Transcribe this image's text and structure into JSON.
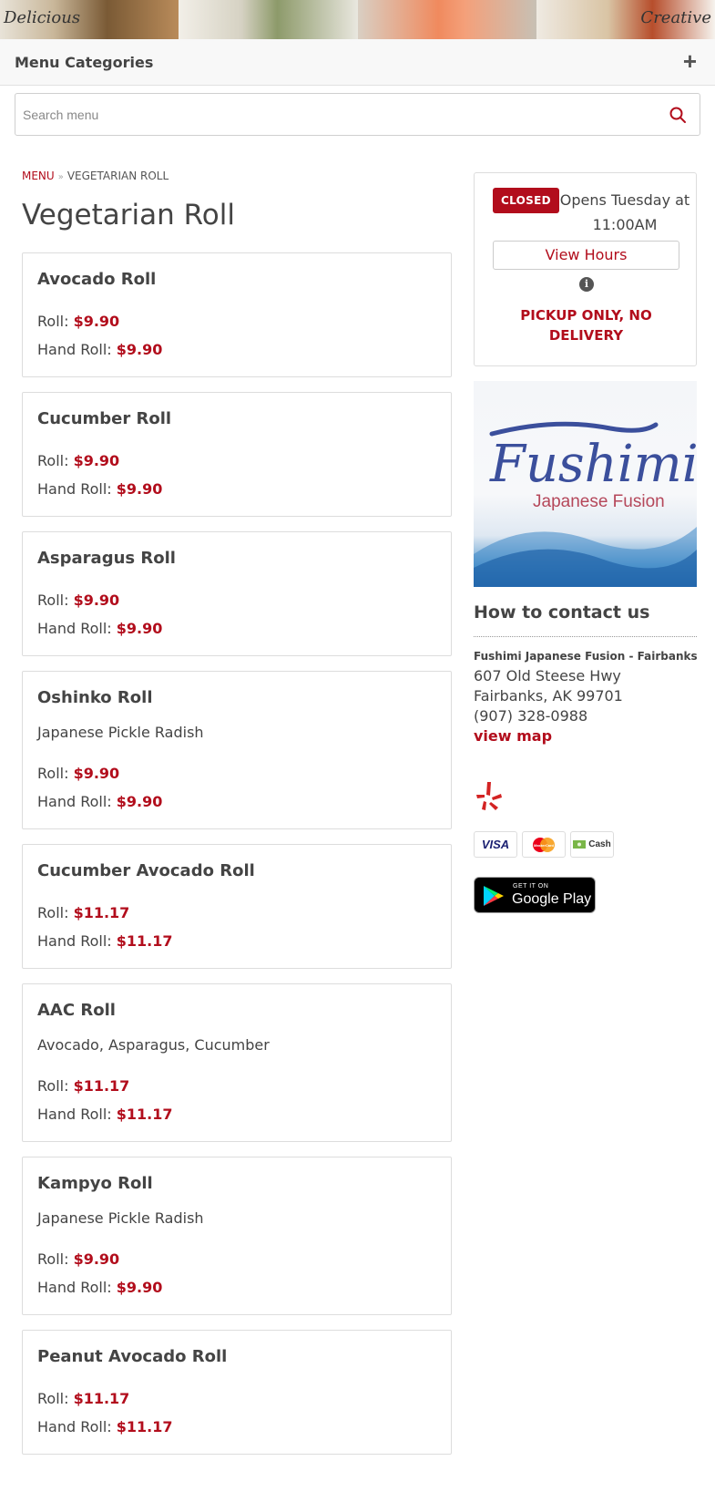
{
  "banner": {
    "left_word": "Delicious",
    "right_word": "Creative"
  },
  "categories_bar": {
    "label": "Menu Categories",
    "toggle": "+"
  },
  "search": {
    "placeholder": "Search menu"
  },
  "breadcrumb": {
    "home": "MENU",
    "separator": "»",
    "current": "VEGETARIAN ROLL"
  },
  "page_title": "Vegetarian Roll",
  "items": [
    {
      "name": "Avocado Roll",
      "description": "",
      "prices": [
        {
          "label": "Roll:",
          "amount": "$9.90"
        },
        {
          "label": "Hand Roll:",
          "amount": "$9.90"
        }
      ]
    },
    {
      "name": "Cucumber Roll",
      "description": "",
      "prices": [
        {
          "label": "Roll:",
          "amount": "$9.90"
        },
        {
          "label": "Hand Roll:",
          "amount": "$9.90"
        }
      ]
    },
    {
      "name": "Asparagus Roll",
      "description": "",
      "prices": [
        {
          "label": "Roll:",
          "amount": "$9.90"
        },
        {
          "label": "Hand Roll:",
          "amount": "$9.90"
        }
      ]
    },
    {
      "name": "Oshinko Roll",
      "description": "Japanese Pickle Radish",
      "prices": [
        {
          "label": "Roll:",
          "amount": "$9.90"
        },
        {
          "label": "Hand Roll:",
          "amount": "$9.90"
        }
      ]
    },
    {
      "name": "Cucumber Avocado Roll",
      "description": "",
      "prices": [
        {
          "label": "Roll:",
          "amount": "$11.17"
        },
        {
          "label": "Hand Roll:",
          "amount": "$11.17"
        }
      ]
    },
    {
      "name": "AAC Roll",
      "description": "Avocado, Asparagus, Cucumber",
      "prices": [
        {
          "label": "Roll:",
          "amount": "$11.17"
        },
        {
          "label": "Hand Roll:",
          "amount": "$11.17"
        }
      ]
    },
    {
      "name": "Kampyo Roll",
      "description": "Japanese Pickle Radish",
      "prices": [
        {
          "label": "Roll:",
          "amount": "$9.90"
        },
        {
          "label": "Hand Roll:",
          "amount": "$9.90"
        }
      ]
    },
    {
      "name": "Peanut Avocado Roll",
      "description": "",
      "prices": [
        {
          "label": "Roll:",
          "amount": "$11.17"
        },
        {
          "label": "Hand Roll:",
          "amount": "$11.17"
        }
      ]
    }
  ],
  "status": {
    "badge": "CLOSED",
    "opens_text": "Opens Tuesday at 11:00AM",
    "view_hours": "View Hours",
    "info_glyph": "i",
    "notice": "PICKUP ONLY, NO DELIVERY"
  },
  "logo": {
    "name": "Fushimi",
    "tagline": "Japanese Fusion"
  },
  "contact": {
    "heading": "How to contact us",
    "name": "Fushimi Japanese Fusion - Fairbanks",
    "address1": "607 Old Steese Hwy",
    "address2": "Fairbanks, AK 99701",
    "phone": "(907) 328-0988",
    "map_link": "view map"
  },
  "payments": {
    "visa": "VISA",
    "mastercard": "MasterCard",
    "cash": "Cash"
  },
  "google_play": {
    "small": "GET IT ON",
    "big": "Google Play"
  },
  "colors": {
    "accent": "#b20d1c",
    "text": "#444444",
    "border": "#dddddd"
  },
  "icons": {
    "search": "search-icon",
    "info": "info-icon",
    "yelp": "yelp-icon"
  }
}
